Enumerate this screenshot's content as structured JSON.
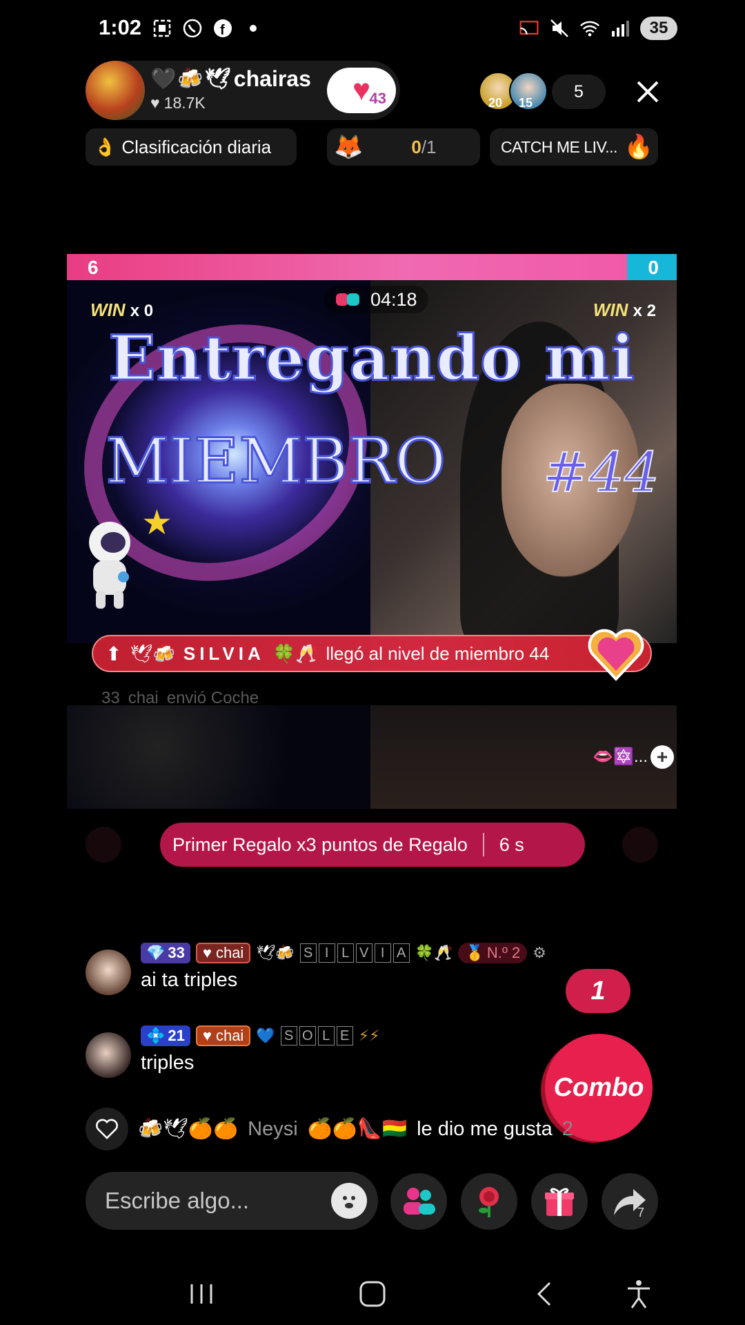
{
  "status_bar": {
    "time": "1:02",
    "battery": "35",
    "left_icons": [
      "screenshot-icon",
      "whatsapp-icon",
      "facebook-icon",
      "dot-icon"
    ],
    "right_icons": [
      "cast-icon",
      "mute-icon",
      "wifi-icon",
      "signal-icon"
    ]
  },
  "host": {
    "name": "chairas",
    "name_prefix_emoji": "🖤🍻🕊",
    "likes": "18.7K",
    "follow_count": "43"
  },
  "viewers": {
    "avatars": [
      {
        "badge": "20",
        "color": "#c9a12a"
      },
      {
        "badge": "15",
        "color": "#4a8ab0"
      }
    ],
    "count": "5"
  },
  "chips": {
    "ranking": "Clasificación diaria",
    "goal_current": "0",
    "goal_total": "/1",
    "catch": "CATCH ME LIV..."
  },
  "battle": {
    "score_left": "6",
    "score_right": "0",
    "timer": "04:18",
    "win_left_label": "WIN",
    "win_left_count": "x 0",
    "win_right_label": "WIN",
    "win_right_count": "x 2",
    "title_line1": "Entregando mi",
    "title_line2": "MIEMBRO",
    "title_line3": "#44",
    "level_banner_emoji": "🕊🍻",
    "level_banner_name": "SILVIA",
    "level_banner_suffix_emoji": "🍀🥂",
    "level_banner_text": "llegó al nivel de miembro 44",
    "ghost_line": "envió Coche",
    "ghost_level": "33",
    "ghost_club": "chai",
    "lower_right_icons": "👄🔯..."
  },
  "gift_banner": {
    "text": "Primer Regalo x3 puntos de Regalo",
    "time": "6 s"
  },
  "chat": [
    {
      "level": "33",
      "club": "chai",
      "emoji_prefix": "🕊🍻",
      "name_letters": [
        "S",
        "I",
        "L",
        "V",
        "I",
        "A"
      ],
      "emoji_suffix": "🍀🥂",
      "rank": "N.º 2",
      "text": "ai ta triples"
    },
    {
      "level": "21",
      "club": "chai",
      "emoji_prefix": "💙",
      "name_letters": [
        "S",
        "O",
        "L",
        "E"
      ],
      "emoji_suffix": "⚡⚡",
      "text": "triples"
    }
  ],
  "like_line": {
    "prefix_emoji": "🍻🕊🍊🍊",
    "name": "Neysi",
    "suffix_emoji": "🍊🍊👠🇧🇴",
    "text": "le dio me gusta",
    "trailing": "2"
  },
  "combo": {
    "count": "1",
    "label": "Combo"
  },
  "bottom_bar": {
    "placeholder": "Escribe algo...",
    "share_count": "7"
  },
  "colors": {
    "accent_pink": "#e8204e",
    "score_pink": "#e93d82",
    "score_blue": "#16b7d8",
    "banner_red": "#c02030"
  }
}
